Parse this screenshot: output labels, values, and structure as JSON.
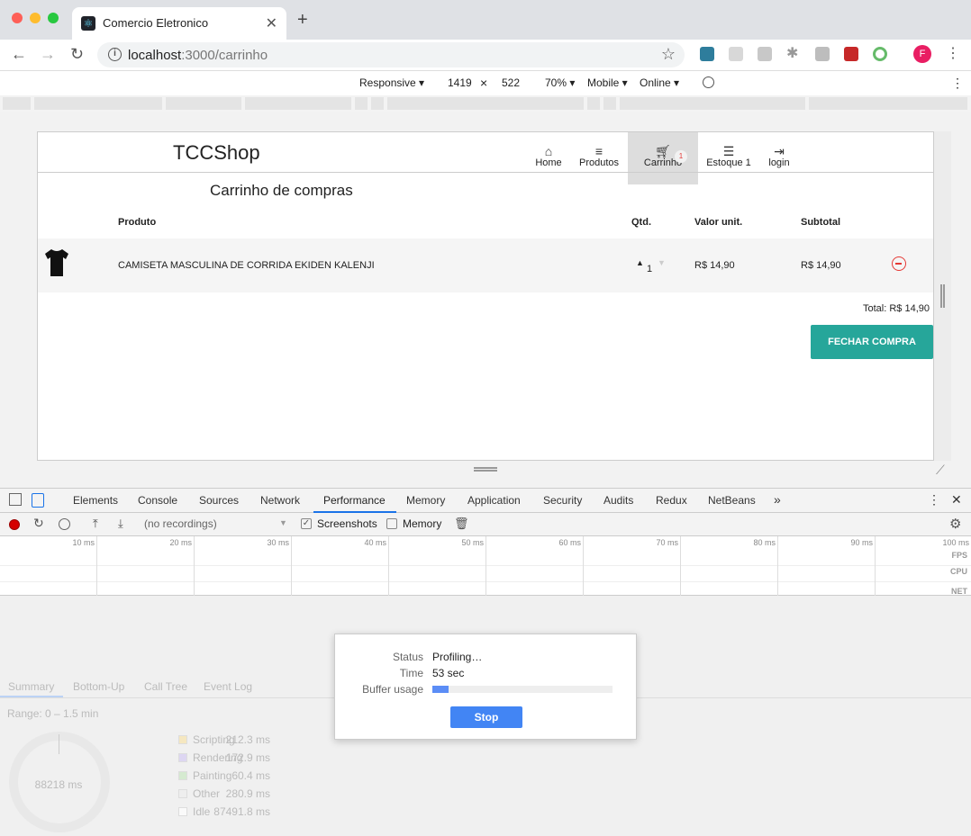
{
  "browser": {
    "tab_title": "Comercio Eletronico",
    "url_host": "localhost",
    "url_path": ":3000/carrinho",
    "avatar_letter": "F",
    "new_tab_label": "+",
    "close_tab_label": "✕"
  },
  "device_toolbar": {
    "mode": "Responsive ▾",
    "width": "1419",
    "times": "×",
    "height": "522",
    "zoom": "70% ▾",
    "device": "Mobile ▾",
    "network": "Online ▾"
  },
  "site": {
    "logo": "TCCShop",
    "nav": [
      {
        "label": "Home",
        "icon": "home-icon"
      },
      {
        "label": "Produtos",
        "icon": "list-icon"
      },
      {
        "label": "Carrinho",
        "icon": "cart-icon",
        "badge": "1",
        "active": true
      },
      {
        "label": "Estoque 1",
        "icon": "stock-icon"
      },
      {
        "label": "login",
        "icon": "login-icon"
      }
    ],
    "heading": "Carrinho de compras",
    "columns": [
      "Produto",
      "Qtd.",
      "Valor unit.",
      "Subtotal"
    ],
    "cart_items": [
      {
        "name": "CAMISETA MASCULINA DE CORRIDA EKIDEN KALENJI",
        "qty": "1",
        "unit": "R$ 14,90",
        "subtotal": "R$ 14,90"
      }
    ],
    "total": "Total: R$ 14,90",
    "checkout_label": "FECHAR COMPRA"
  },
  "devtools": {
    "tabs": [
      "Elements",
      "Console",
      "Sources",
      "Network",
      "Performance",
      "Memory",
      "Application",
      "Security",
      "Audits",
      "Redux",
      "NetBeans"
    ],
    "more_tabs": "»",
    "active_tab": "Performance",
    "recordings": "(no recordings)",
    "screenshots_label": "Screenshots",
    "memory_label": "Memory",
    "timeline_ticks": [
      "10 ms",
      "20 ms",
      "30 ms",
      "40 ms",
      "50 ms",
      "60 ms",
      "70 ms",
      "80 ms",
      "90 ms",
      "100 ms"
    ],
    "tracks": [
      "FPS",
      "CPU",
      "NET"
    ],
    "summary_tabs": [
      "Summary",
      "Bottom-Up",
      "Call Tree",
      "Event Log"
    ],
    "range": "Range: 0 – 1.5 min",
    "pie_total": "88218 ms",
    "legend": [
      {
        "value": "212.3 ms",
        "name": "Scripting",
        "color": "#f5e7c0"
      },
      {
        "value": "172.9 ms",
        "name": "Rendering",
        "color": "#ddd6f2"
      },
      {
        "value": "60.4 ms",
        "name": "Painting",
        "color": "#d5ead0"
      },
      {
        "value": "280.9 ms",
        "name": "Other",
        "color": "#eeeeee"
      },
      {
        "value": "87491.8 ms",
        "name": "Idle",
        "color": "#fafafa"
      }
    ],
    "profiling": {
      "status_key": "Status",
      "status": "Profiling…",
      "time_key": "Time",
      "time": "53 sec",
      "buffer_key": "Buffer usage",
      "buffer_fraction": 0.09,
      "stop_label": "Stop"
    }
  }
}
